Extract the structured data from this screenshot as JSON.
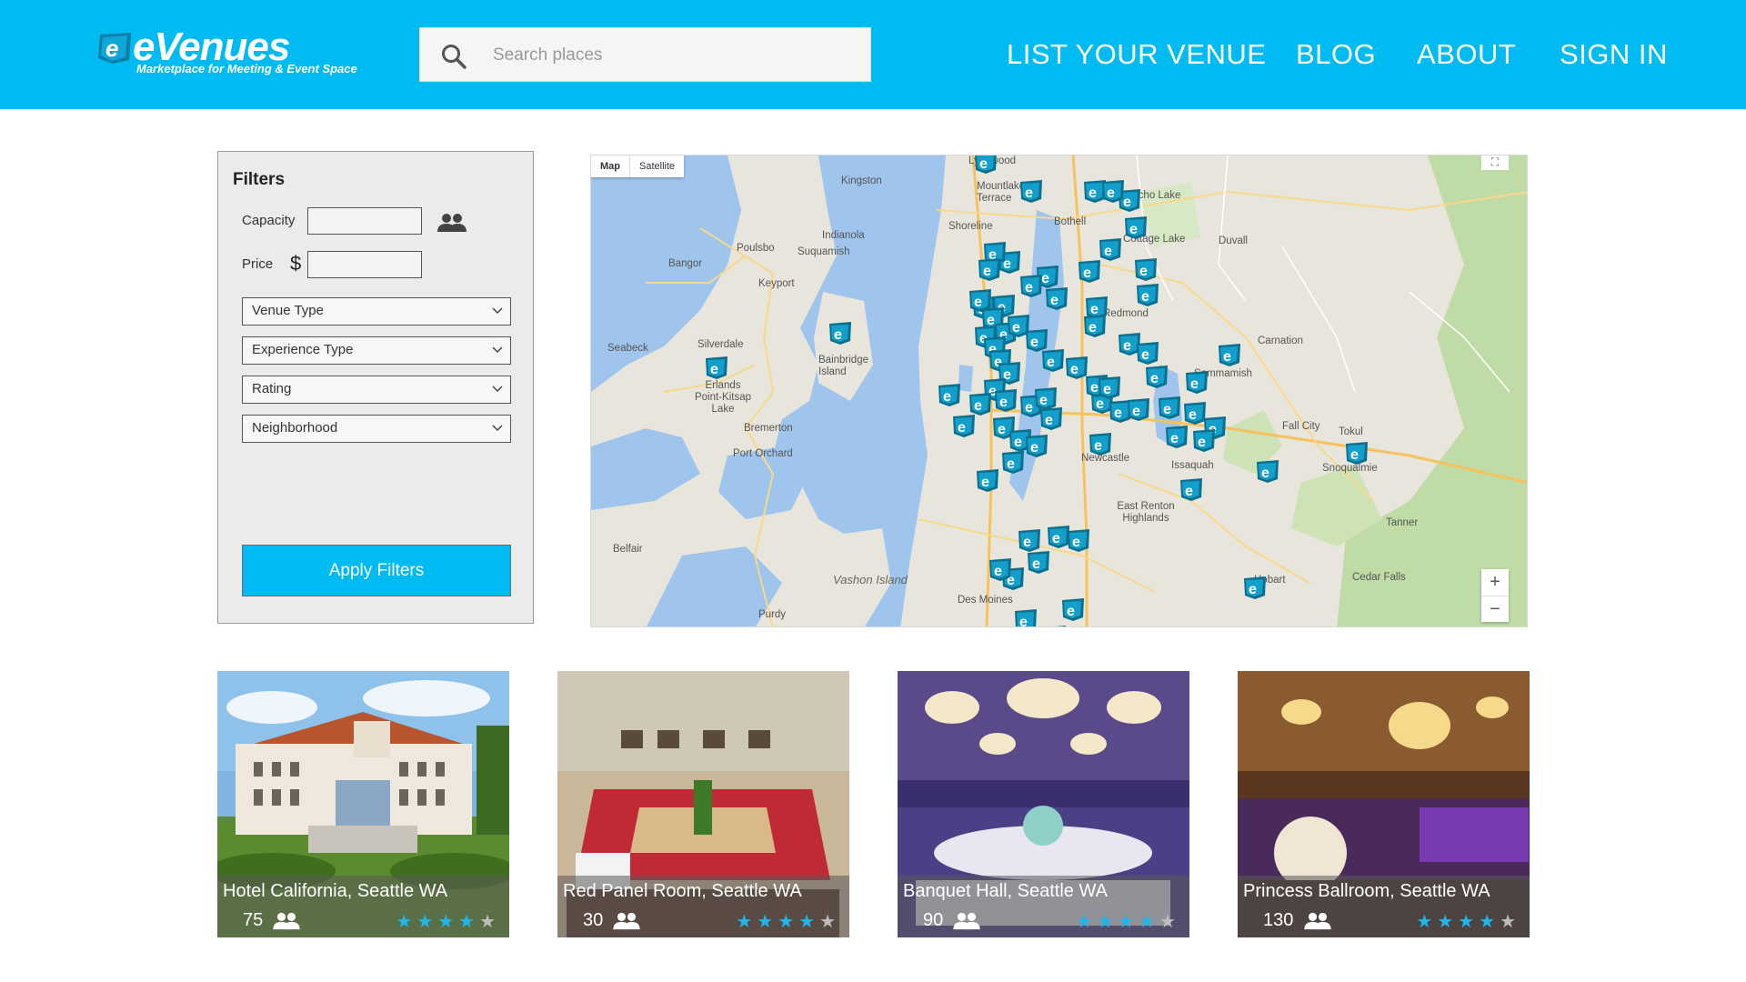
{
  "brand": {
    "logo_text": "eVenues",
    "tagline": "Marketplace for Meeting & Event Space",
    "accent_color": "#00baf2"
  },
  "search": {
    "placeholder": "Search places",
    "value": ""
  },
  "nav": {
    "items": [
      {
        "label": "LIST YOUR VENUE"
      },
      {
        "label": "BLOG"
      },
      {
        "label": "ABOUT"
      },
      {
        "label": "SIGN IN"
      }
    ]
  },
  "filters": {
    "title": "Filters",
    "capacity_label": "Capacity",
    "capacity_value": "",
    "price_label": "Price",
    "price_symbol": "$",
    "price_value": "",
    "selects": [
      {
        "label": "Venue Type"
      },
      {
        "label": "Experience Type"
      },
      {
        "label": "Rating"
      },
      {
        "label": "Neighborhood"
      }
    ],
    "apply_label": "Apply Filters"
  },
  "map": {
    "type_options": [
      "Map",
      "Satellite"
    ],
    "selected_type": "Map",
    "zoom_in": "+",
    "zoom_out": "−",
    "marker_icon": "evenues-pin-icon",
    "places": [
      {
        "name": "Lynnwood"
      },
      {
        "name": "Mountlake Terrace"
      },
      {
        "name": "Kingston"
      },
      {
        "name": "Echo Lake"
      },
      {
        "name": "Shoreline"
      },
      {
        "name": "Bothell"
      },
      {
        "name": "Cottage Lake"
      },
      {
        "name": "Duvall"
      },
      {
        "name": "Indianola"
      },
      {
        "name": "Poulsbo"
      },
      {
        "name": "Suquamish"
      },
      {
        "name": "Bangor"
      },
      {
        "name": "Keyport"
      },
      {
        "name": "Redmond"
      },
      {
        "name": "Carnation"
      },
      {
        "name": "Seabeck"
      },
      {
        "name": "Silverdale"
      },
      {
        "name": "Bainbridge Island"
      },
      {
        "name": "Sammamish"
      },
      {
        "name": "Erlands Point-Kitsap Lake"
      },
      {
        "name": "Bremerton"
      },
      {
        "name": "Fall City"
      },
      {
        "name": "Tokul"
      },
      {
        "name": "Snoqualmie"
      },
      {
        "name": "Port Orchard"
      },
      {
        "name": "Newcastle"
      },
      {
        "name": "Issaquah"
      },
      {
        "name": "East Renton Highlands"
      },
      {
        "name": "Tanner"
      },
      {
        "name": "Belfair"
      },
      {
        "name": "Vashon Island"
      },
      {
        "name": "Hobart"
      },
      {
        "name": "Cedar Falls"
      },
      {
        "name": "Purdy"
      },
      {
        "name": "Des Moines"
      }
    ]
  },
  "venues": [
    {
      "name": "Hotel California, Seattle WA",
      "capacity": "75",
      "rating": 4,
      "max_rating": 5
    },
    {
      "name": "Red Panel Room, Seattle WA",
      "capacity": "30",
      "rating": 4,
      "max_rating": 5
    },
    {
      "name": "Banquet Hall, Seattle WA",
      "capacity": "90",
      "rating": 4,
      "max_rating": 5
    },
    {
      "name": "Princess Ballroom, Seattle WA",
      "capacity": "130",
      "rating": 4,
      "max_rating": 5
    }
  ]
}
